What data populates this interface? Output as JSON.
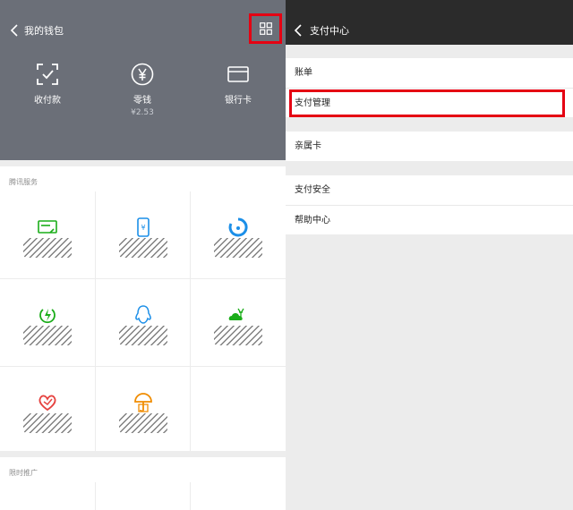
{
  "wallet": {
    "title": "我的钱包",
    "items": [
      {
        "label": "收付款",
        "icon": "scan-pay-icon"
      },
      {
        "label": "零钱",
        "sub": "¥2.53",
        "icon": "yuan-coin-icon"
      },
      {
        "label": "银行卡",
        "icon": "bank-card-icon"
      }
    ]
  },
  "services": {
    "title": "腾讯服务",
    "items": [
      {
        "icon": "credit-card-repay-icon",
        "color": "#1aad19"
      },
      {
        "icon": "phone-recharge-icon",
        "color": "#1c8fe8"
      },
      {
        "icon": "wealth-management-icon",
        "color": "#1c8fe8"
      },
      {
        "icon": "utilities-lightning-icon",
        "color": "#1aad19"
      },
      {
        "icon": "qq-penguin-icon",
        "color": "#1c8fe8"
      },
      {
        "icon": "city-service-icon",
        "color": "#1aad19"
      },
      {
        "icon": "charity-heart-icon",
        "color": "#e64340"
      },
      {
        "icon": "insurance-umbrella-icon",
        "color": "#f08c00"
      }
    ]
  },
  "promo": {
    "title": "限时推广"
  },
  "pay_center": {
    "title": "支付中心",
    "groups": [
      [
        "账单",
        "支付管理"
      ],
      [
        "亲属卡"
      ],
      [
        "支付安全",
        "帮助中心"
      ]
    ]
  },
  "colors": {
    "header": "#6b6f78",
    "highlight": "#e50012",
    "topbar": "#2b2b2b"
  }
}
